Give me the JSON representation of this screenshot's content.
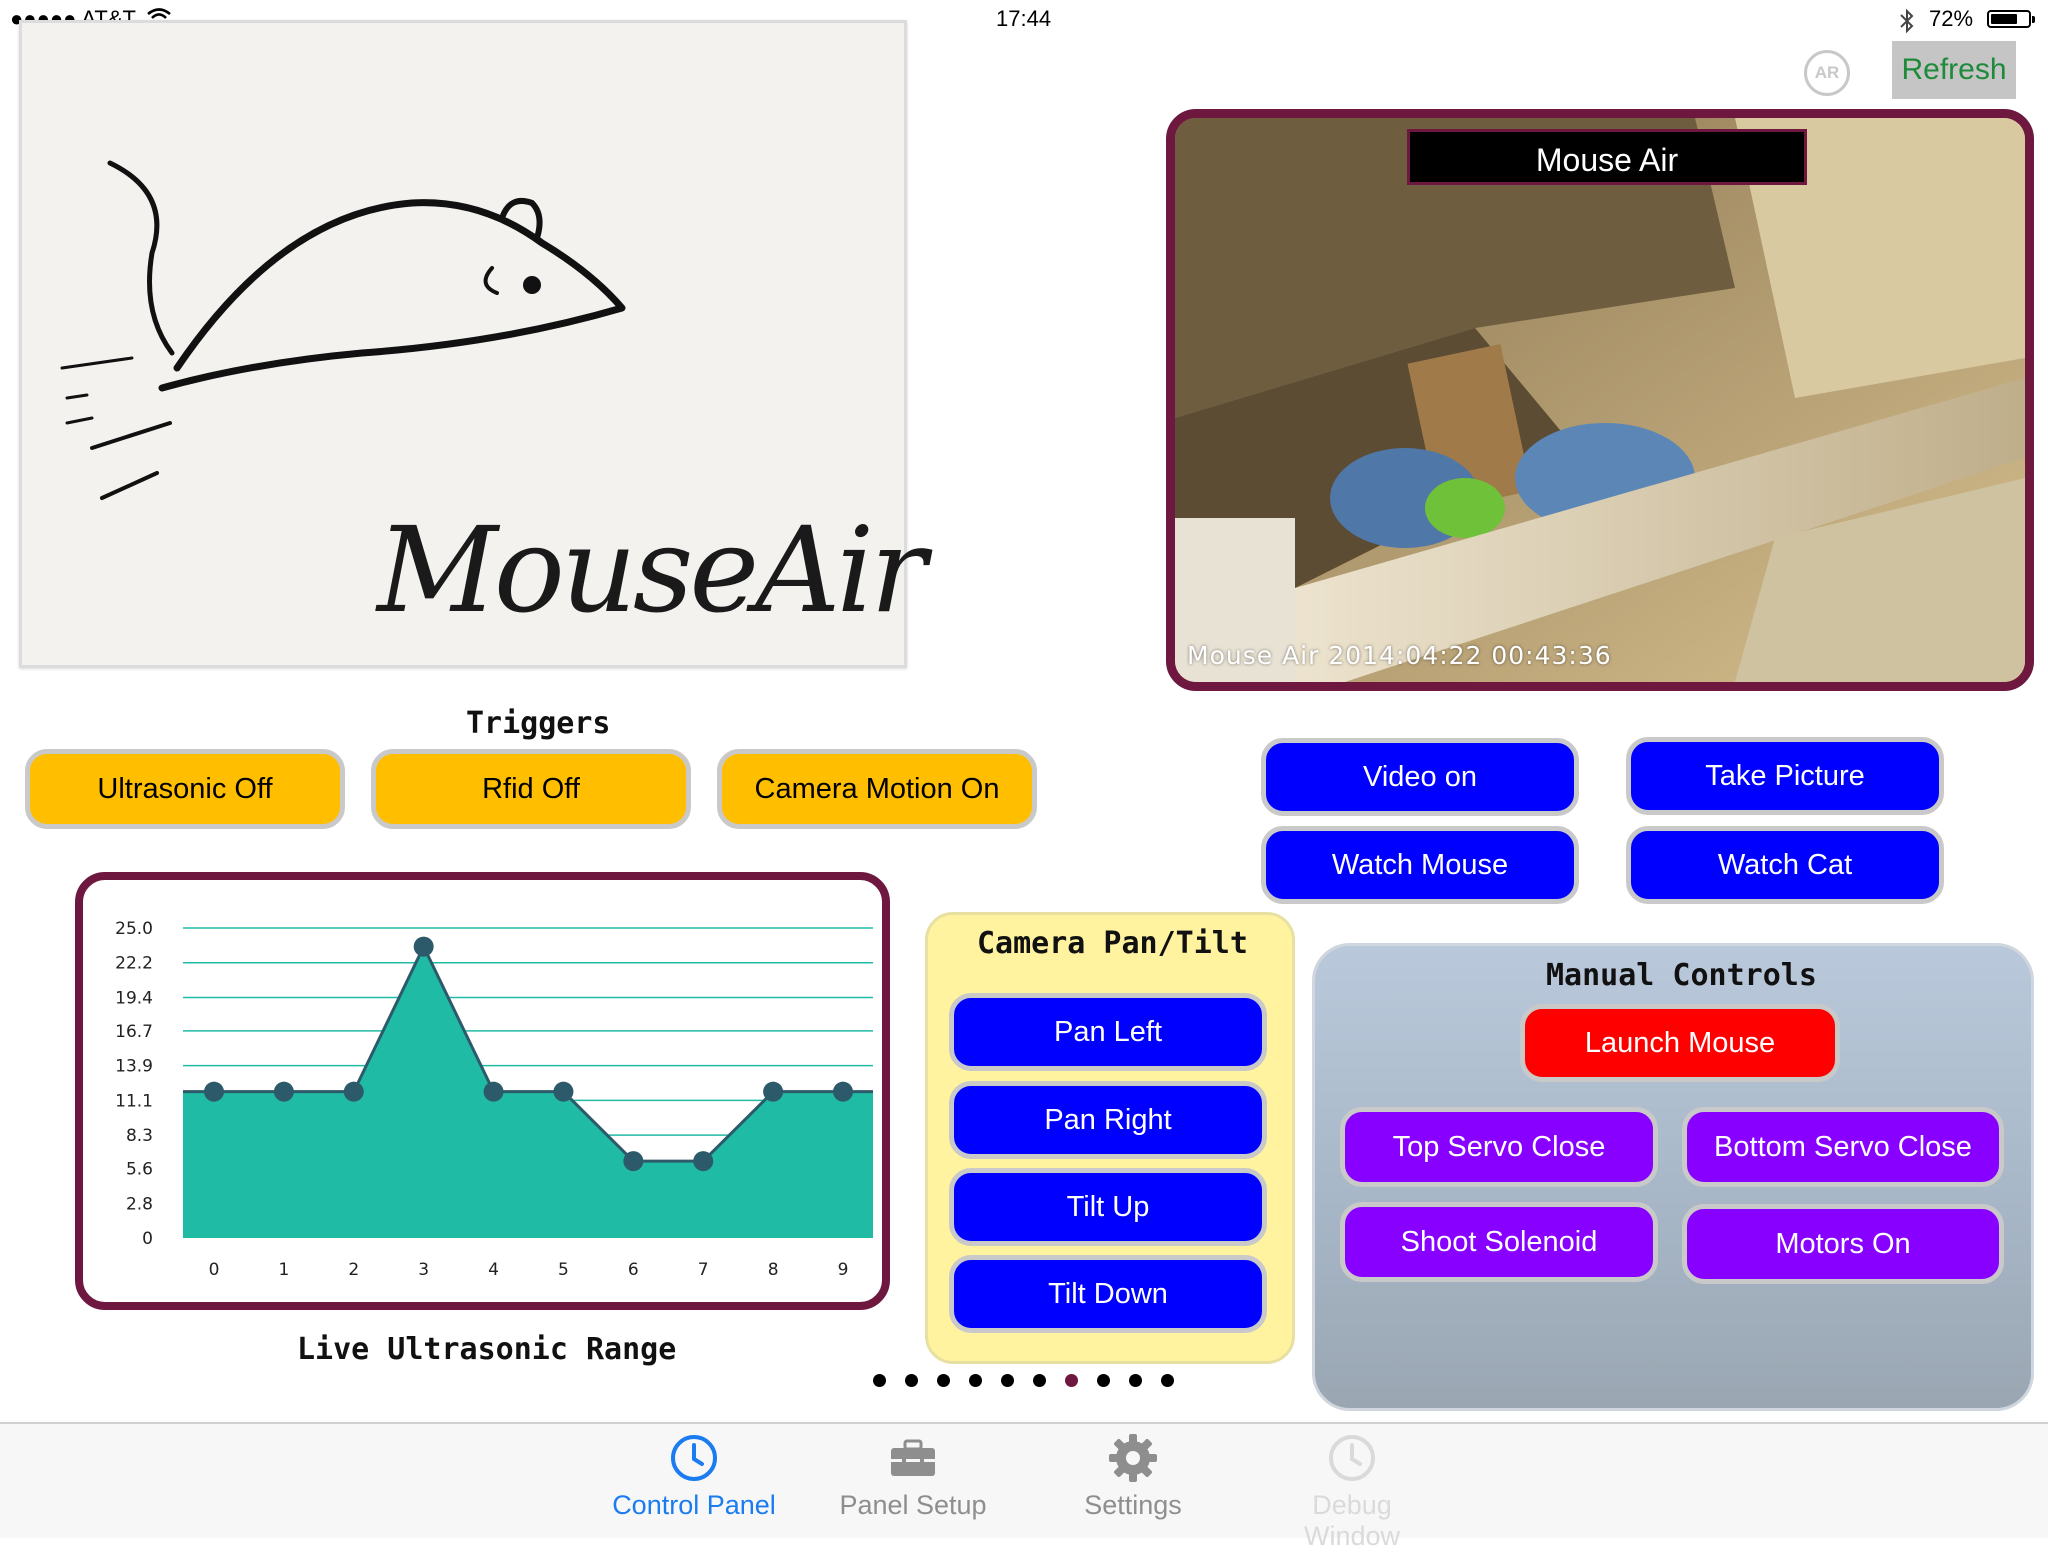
{
  "status_bar": {
    "carrier": "●●●●● AT&T",
    "time": "17:44",
    "battery_percent": "72%",
    "battery_level": 0.72
  },
  "header": {
    "ar_label": "AR",
    "refresh_label": "Refresh"
  },
  "logo": {
    "text": "MouseAir"
  },
  "camera": {
    "title": "Mouse Air",
    "timestamp": "Mouse Air 2014:04:22 00:43:36"
  },
  "triggers": {
    "title": "Triggers",
    "buttons": [
      "Ultrasonic Off",
      "Rfid Off",
      "Camera Motion On"
    ]
  },
  "camera_actions": {
    "video": "Video on",
    "take_picture": "Take Picture",
    "watch_mouse": "Watch Mouse",
    "watch_cat": "Watch Cat"
  },
  "chart_title": "Live Ultrasonic Range",
  "chart_data": {
    "type": "area",
    "title": "Live Ultrasonic Range",
    "x": [
      0,
      1,
      2,
      3,
      4,
      5,
      6,
      7,
      8,
      9
    ],
    "values": [
      11.8,
      11.8,
      11.8,
      23.5,
      11.8,
      11.8,
      6.2,
      6.2,
      11.8,
      11.8
    ],
    "y_ticks": [
      "0",
      "2.8",
      "5.6",
      "8.3",
      "11.1",
      "13.9",
      "16.7",
      "19.4",
      "22.2",
      "25.0"
    ],
    "ylim": [
      0,
      25
    ],
    "grid": true,
    "fill_color": "#20bba4",
    "point_color": "#2d5a6a"
  },
  "pan_tilt": {
    "title": "Camera Pan/Tilt",
    "buttons": [
      "Pan Left",
      "Pan Right",
      "Tilt Up",
      "Tilt Down"
    ]
  },
  "manual_controls": {
    "title": "Manual Controls",
    "launch": "Launch Mouse",
    "top_servo": "Top Servo Close",
    "bottom_servo": "Bottom Servo Close",
    "shoot": "Shoot Solenoid",
    "motors": "Motors On"
  },
  "pager": {
    "count": 10,
    "active_index": 6
  },
  "tabbar": {
    "tabs": [
      "Control Panel",
      "Panel Setup",
      "Settings",
      "Debug Window"
    ]
  },
  "colors": {
    "accent_maroon": "#6e1840",
    "button_blue": "#0000ff",
    "button_purple": "#8800ff",
    "button_red": "#ff0000",
    "button_yellow": "#ffbe00",
    "tab_active": "#1a7cf0"
  }
}
